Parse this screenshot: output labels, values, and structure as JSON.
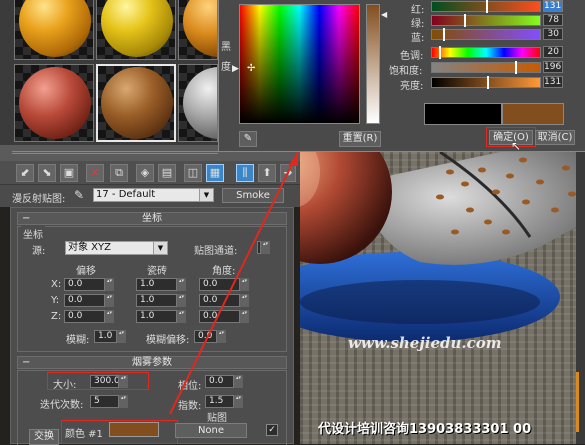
{
  "color_picker": {
    "side_label_1": "黑",
    "side_label_2": "度",
    "channels": [
      {
        "label": "红:",
        "value": "131"
      },
      {
        "label": "绿:",
        "value": "78"
      },
      {
        "label": "蓝:",
        "value": "30"
      },
      {
        "label": "色调:",
        "value": "20"
      },
      {
        "label": "饱和度:",
        "value": "196"
      },
      {
        "label": "亮度:",
        "value": "131"
      }
    ],
    "reset_label": "重置(R)",
    "ok_label": "确定(O)",
    "cancel_label": "取消(C)",
    "swatch_old": "#000000",
    "swatch_new": "#834e1e"
  },
  "material_editor": {
    "map_label": "漫反射贴图:",
    "map_name": "17 - Default",
    "map_type": "Smoke",
    "coordinates": {
      "title": "坐标",
      "group_label": "坐标",
      "source_label": "源:",
      "source_value": "对象 XYZ",
      "map_channel_label": "贴图通道:",
      "map_channel_value": "1",
      "offset_label": "偏移",
      "tiling_label": "瓷砖",
      "angle_label": "角度:",
      "axis": [
        "X:",
        "Y:",
        "Z:"
      ],
      "offset": [
        "0.0",
        "0.0",
        "0.0"
      ],
      "tiling": [
        "1.0",
        "1.0",
        "1.0"
      ],
      "angle": [
        "0.0",
        "0.0",
        "0.0"
      ],
      "blur_label": "模糊:",
      "blur_value": "1.0",
      "blur_offset_label": "模糊偏移:",
      "blur_offset_value": "0.0"
    },
    "smoke_params": {
      "title": "烟雾参数",
      "size_label": "大小:",
      "size_value": "300.0",
      "phase_label": "相位:",
      "phase_value": "0.0",
      "iterations_label": "迭代次数:",
      "iterations_value": "5",
      "exponent_label": "指数:",
      "exponent_value": "1.5",
      "maps_label": "贴图",
      "swap_label": "交换",
      "color1_label": "颜色 #1",
      "color1_value": "#834e1e",
      "none_label": "None"
    }
  },
  "viewport": {
    "watermark_url": "www.shejiedu.com",
    "watermark_ad": "代设计培训咨询13903833301 00"
  }
}
